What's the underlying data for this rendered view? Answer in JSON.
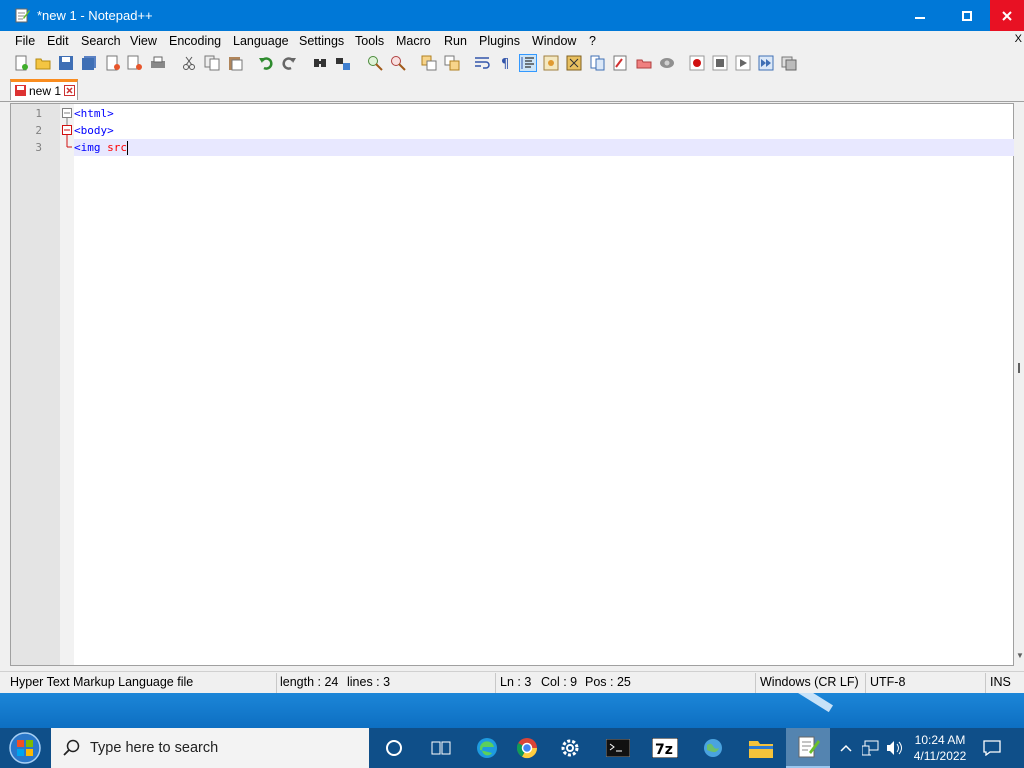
{
  "window": {
    "title": "*new 1 - Notepad++"
  },
  "menu": {
    "items": [
      "File",
      "Edit",
      "Search",
      "View",
      "Encoding",
      "Language",
      "Settings",
      "Tools",
      "Macro",
      "Run",
      "Plugins",
      "Window",
      "?"
    ],
    "close_glyph": "X"
  },
  "toolbar": {
    "icons": [
      "new-file",
      "open-file",
      "save",
      "save-all",
      "close",
      "close-all",
      "print",
      "cut",
      "copy",
      "paste",
      "undo",
      "redo",
      "find",
      "replace",
      "zoom-in",
      "zoom-out",
      "sync-vertical",
      "sync-horizontal",
      "word-wrap",
      "show-all-characters",
      "indent-guide",
      "user-defined-language",
      "document-map",
      "function-list",
      "folder-as-workspace",
      "monitoring",
      "record-macro",
      "stop-recording",
      "playback",
      "run-macro-multiple",
      "save-macro"
    ]
  },
  "tabs": [
    {
      "label": "new 1",
      "modified": true
    }
  ],
  "editor": {
    "lines": [
      {
        "number": "1",
        "tag": "<html>",
        "attr": ""
      },
      {
        "number": "2",
        "tag": "<body>",
        "attr": ""
      },
      {
        "number": "3",
        "tag": "<img",
        "attr": " src"
      }
    ],
    "current_line": 3
  },
  "statusbar": {
    "file_type": "Hyper Text Markup Language file",
    "length": "length : 24",
    "lines": "lines : 3",
    "ln": "Ln : 3",
    "col": "Col : 9",
    "pos": "Pos : 25",
    "eol": "Windows (CR LF)",
    "encoding": "UTF-8",
    "mode": "INS"
  },
  "taskbar": {
    "search_placeholder": "Type here to search",
    "time": "10:24 AM",
    "date": "4/11/2022"
  },
  "colors": {
    "titlebar": "#0078d7",
    "close_button": "#e81123",
    "tag": "#0000ff",
    "attribute": "#ff0000",
    "current_line": "#e8e8ff",
    "tab_accent": "#fa8c1e",
    "taskbar": "#0f4f89"
  }
}
